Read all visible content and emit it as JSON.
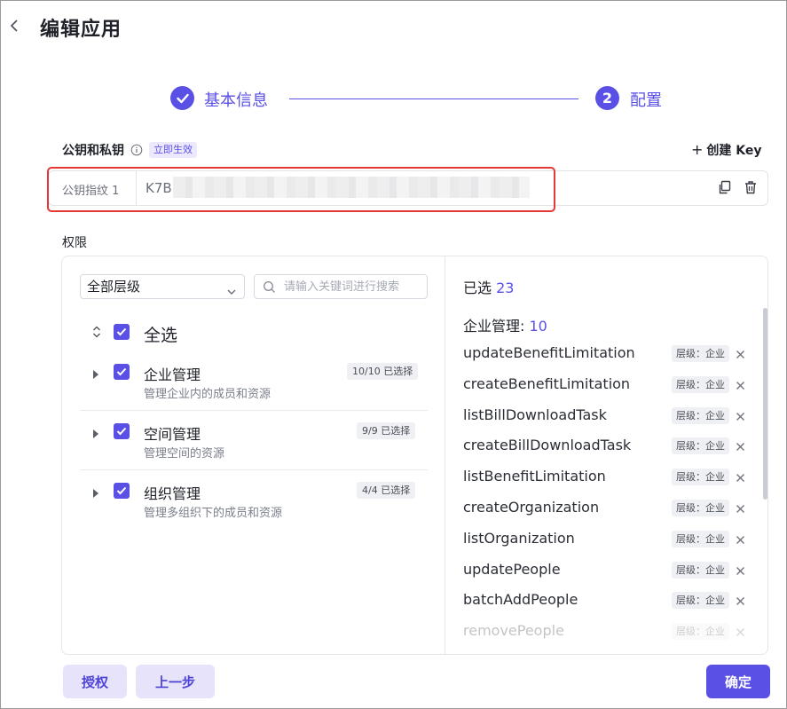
{
  "header": {
    "title": "编辑应用"
  },
  "steps": [
    {
      "label": "基本信息",
      "state": "done"
    },
    {
      "number": "2",
      "label": "配置",
      "state": "active"
    }
  ],
  "keys": {
    "section_label": "公钥和私钥",
    "tag": "立即生效",
    "create_key_label": "创建 Key",
    "row_label": "公钥指纹 1",
    "value_prefix": "K7B"
  },
  "permissions": {
    "section_label": "权限",
    "level_select": {
      "selected": "全部层级"
    },
    "search": {
      "placeholder": "请输入关键词进行搜索"
    },
    "select_all_label": "全选",
    "groups": [
      {
        "title": "企业管理",
        "desc": "管理企业内的成员和资源",
        "badge": "10/10 已选择"
      },
      {
        "title": "空间管理",
        "desc": "管理空间的资源",
        "badge": "9/9 已选择"
      },
      {
        "title": "组织管理",
        "desc": "管理多组织下的成员和资源",
        "badge": "4/4 已选择"
      }
    ],
    "selected_label": "已选",
    "selected_count": "23",
    "category": {
      "name": "企业管理:",
      "count": "10"
    },
    "items": [
      {
        "name": "updateBenefitLimitation",
        "tag": "层级：企业"
      },
      {
        "name": "createBenefitLimitation",
        "tag": "层级：企业"
      },
      {
        "name": "listBillDownloadTask",
        "tag": "层级：企业"
      },
      {
        "name": "createBillDownloadTask",
        "tag": "层级：企业"
      },
      {
        "name": "listBenefitLimitation",
        "tag": "层级：企业"
      },
      {
        "name": "createOrganization",
        "tag": "层级：企业"
      },
      {
        "name": "listOrganization",
        "tag": "层级：企业"
      },
      {
        "name": "updatePeople",
        "tag": "层级：企业"
      },
      {
        "name": "batchAddPeople",
        "tag": "层级：企业"
      },
      {
        "name": "removePeople",
        "tag": "层级：企业"
      }
    ]
  },
  "footer": {
    "authorize_label": "授权",
    "prev_label": "上一步",
    "confirm_label": "确定"
  },
  "colors": {
    "accent": "#5b50e6",
    "highlight": "#e53935"
  }
}
